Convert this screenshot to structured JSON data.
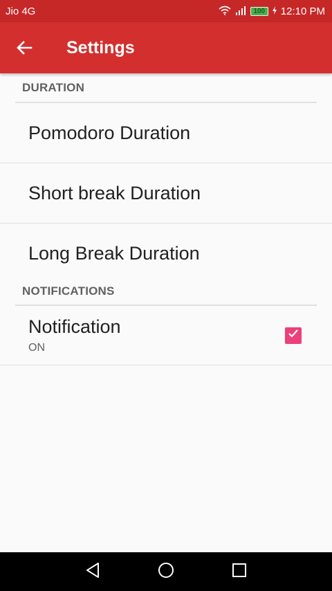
{
  "status_bar": {
    "carrier": "Jio 4G",
    "battery": "100",
    "time": "12:10 PM",
    "icons": [
      "wifi-icon",
      "signal-icon",
      "battery-icon",
      "charging-icon"
    ]
  },
  "app_bar": {
    "title": "Settings",
    "back_icon": "arrow-back-icon"
  },
  "sections": {
    "duration": {
      "header": "DURATION",
      "items": [
        {
          "title": "Pomodoro Duration"
        },
        {
          "title": "Short break Duration"
        },
        {
          "title": "Long Break Duration"
        }
      ]
    },
    "notifications": {
      "header": "NOTIFICATIONS",
      "item": {
        "title": "Notification",
        "summary": "ON",
        "checked": true
      }
    }
  },
  "colors": {
    "app_bar": "#d32f2f",
    "status_bar": "#c62828",
    "checkbox_accent": "#ec407a"
  },
  "nav_bar": {
    "icons": [
      "back-triangle-icon",
      "home-circle-icon",
      "recents-square-icon"
    ]
  }
}
